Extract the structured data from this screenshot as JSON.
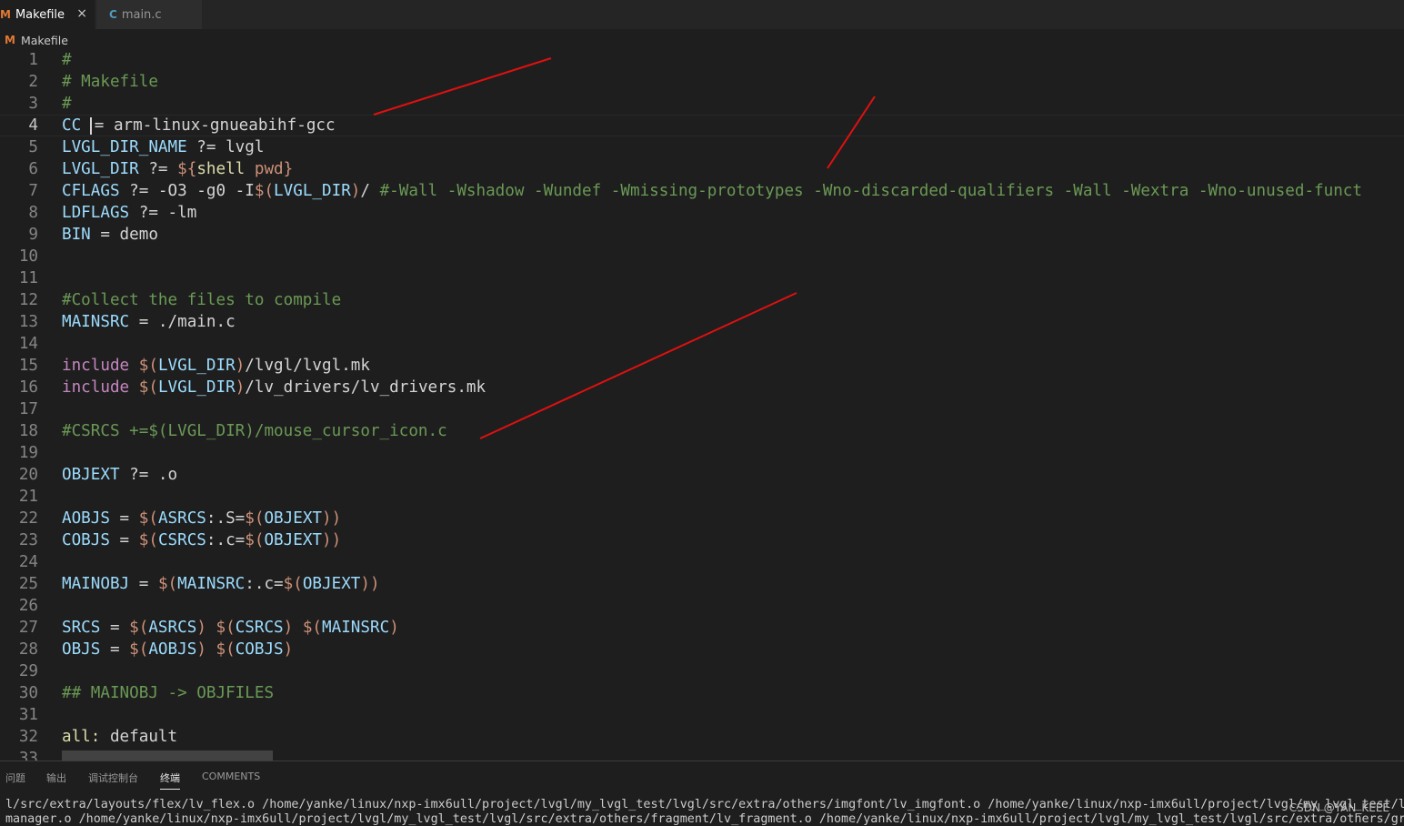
{
  "tabs": [
    {
      "icon": "M",
      "label": "Makefile",
      "active": true,
      "close": "×"
    },
    {
      "icon": "C",
      "label": "main.c",
      "active": false
    }
  ],
  "breadcrumb": {
    "icon": "M",
    "label": "Makefile"
  },
  "current_line": 4,
  "colors": {
    "background": "#1e1e1e",
    "comment": "#6a9955",
    "variable": "#9cdcfe",
    "keyword": "#c586c0",
    "dollar": "#ce9178",
    "function": "#dcdcaa",
    "annotation": "#e01010"
  },
  "editor": {
    "lines": [
      {
        "n": "1",
        "tokens": [
          {
            "t": "#",
            "c": "com"
          }
        ]
      },
      {
        "n": "2",
        "tokens": [
          {
            "t": "# Makefile",
            "c": "com"
          }
        ]
      },
      {
        "n": "3",
        "tokens": [
          {
            "t": "#",
            "c": "com"
          }
        ]
      },
      {
        "n": "4",
        "tokens": [
          {
            "t": "CC",
            "c": "var"
          },
          {
            "t": " ",
            "c": "txt"
          },
          {
            "t": "",
            "c": "cursor"
          },
          {
            "t": "= arm-linux-gnueabihf-gcc",
            "c": "txt"
          }
        ]
      },
      {
        "n": "5",
        "tokens": [
          {
            "t": "LVGL_DIR_NAME",
            "c": "var"
          },
          {
            "t": " ?= lvgl",
            "c": "txt"
          }
        ]
      },
      {
        "n": "6",
        "tokens": [
          {
            "t": "LVGL_DIR",
            "c": "var"
          },
          {
            "t": " ?= ",
            "c": "txt"
          },
          {
            "t": "${",
            "c": "dol"
          },
          {
            "t": "shell",
            "c": "fn"
          },
          {
            "t": " pwd}",
            "c": "dol"
          }
        ]
      },
      {
        "n": "7",
        "tokens": [
          {
            "t": "CFLAGS",
            "c": "var"
          },
          {
            "t": " ?= -O3 -g0 -I",
            "c": "txt"
          },
          {
            "t": "$(",
            "c": "dol"
          },
          {
            "t": "LVGL_DIR",
            "c": "var"
          },
          {
            "t": ")",
            "c": "dol"
          },
          {
            "t": "/ ",
            "c": "txt"
          },
          {
            "t": "#-Wall -Wshadow -Wundef -Wmissing-prototypes -Wno-discarded-qualifiers -Wall -Wextra -Wno-unused-funct",
            "c": "com"
          }
        ]
      },
      {
        "n": "8",
        "tokens": [
          {
            "t": "LDFLAGS",
            "c": "var"
          },
          {
            "t": " ?= -lm",
            "c": "txt"
          }
        ]
      },
      {
        "n": "9",
        "tokens": [
          {
            "t": "BIN",
            "c": "var"
          },
          {
            "t": " = demo",
            "c": "txt"
          }
        ]
      },
      {
        "n": "10",
        "tokens": []
      },
      {
        "n": "11",
        "tokens": []
      },
      {
        "n": "12",
        "tokens": [
          {
            "t": "#Collect the files to compile",
            "c": "com"
          }
        ]
      },
      {
        "n": "13",
        "tokens": [
          {
            "t": "MAINSRC",
            "c": "var"
          },
          {
            "t": " = ./main.c",
            "c": "txt"
          }
        ]
      },
      {
        "n": "14",
        "tokens": []
      },
      {
        "n": "15",
        "tokens": [
          {
            "t": "include",
            "c": "kw"
          },
          {
            "t": " ",
            "c": "txt"
          },
          {
            "t": "$(",
            "c": "dol"
          },
          {
            "t": "LVGL_DIR",
            "c": "var"
          },
          {
            "t": ")",
            "c": "dol"
          },
          {
            "t": "/lvgl/lvgl.mk",
            "c": "txt"
          }
        ]
      },
      {
        "n": "16",
        "tokens": [
          {
            "t": "include",
            "c": "kw"
          },
          {
            "t": " ",
            "c": "txt"
          },
          {
            "t": "$(",
            "c": "dol"
          },
          {
            "t": "LVGL_DIR",
            "c": "var"
          },
          {
            "t": ")",
            "c": "dol"
          },
          {
            "t": "/lv_drivers/lv_drivers.mk",
            "c": "txt"
          }
        ]
      },
      {
        "n": "17",
        "tokens": []
      },
      {
        "n": "18",
        "tokens": [
          {
            "t": "#CSRCS +=$(LVGL_DIR)/mouse_cursor_icon.c",
            "c": "com"
          }
        ]
      },
      {
        "n": "19",
        "tokens": []
      },
      {
        "n": "20",
        "tokens": [
          {
            "t": "OBJEXT",
            "c": "var"
          },
          {
            "t": " ?= .o",
            "c": "txt"
          }
        ]
      },
      {
        "n": "21",
        "tokens": []
      },
      {
        "n": "22",
        "tokens": [
          {
            "t": "AOBJS",
            "c": "var"
          },
          {
            "t": " = ",
            "c": "txt"
          },
          {
            "t": "$(",
            "c": "dol"
          },
          {
            "t": "ASRCS",
            "c": "var"
          },
          {
            "t": ":.S=",
            "c": "txt"
          },
          {
            "t": "$(",
            "c": "dol"
          },
          {
            "t": "OBJEXT",
            "c": "var"
          },
          {
            "t": "))",
            "c": "dol"
          }
        ]
      },
      {
        "n": "23",
        "tokens": [
          {
            "t": "COBJS",
            "c": "var"
          },
          {
            "t": " = ",
            "c": "txt"
          },
          {
            "t": "$(",
            "c": "dol"
          },
          {
            "t": "CSRCS",
            "c": "var"
          },
          {
            "t": ":.c=",
            "c": "txt"
          },
          {
            "t": "$(",
            "c": "dol"
          },
          {
            "t": "OBJEXT",
            "c": "var"
          },
          {
            "t": "))",
            "c": "dol"
          }
        ]
      },
      {
        "n": "24",
        "tokens": []
      },
      {
        "n": "25",
        "tokens": [
          {
            "t": "MAINOBJ",
            "c": "var"
          },
          {
            "t": " = ",
            "c": "txt"
          },
          {
            "t": "$(",
            "c": "dol"
          },
          {
            "t": "MAINSRC",
            "c": "var"
          },
          {
            "t": ":.c=",
            "c": "txt"
          },
          {
            "t": "$(",
            "c": "dol"
          },
          {
            "t": "OBJEXT",
            "c": "var"
          },
          {
            "t": "))",
            "c": "dol"
          }
        ]
      },
      {
        "n": "26",
        "tokens": []
      },
      {
        "n": "27",
        "tokens": [
          {
            "t": "SRCS",
            "c": "var"
          },
          {
            "t": " = ",
            "c": "txt"
          },
          {
            "t": "$(",
            "c": "dol"
          },
          {
            "t": "ASRCS",
            "c": "var"
          },
          {
            "t": ")",
            "c": "dol"
          },
          {
            "t": " ",
            "c": "txt"
          },
          {
            "t": "$(",
            "c": "dol"
          },
          {
            "t": "CSRCS",
            "c": "var"
          },
          {
            "t": ")",
            "c": "dol"
          },
          {
            "t": " ",
            "c": "txt"
          },
          {
            "t": "$(",
            "c": "dol"
          },
          {
            "t": "MAINSRC",
            "c": "var"
          },
          {
            "t": ")",
            "c": "dol"
          }
        ]
      },
      {
        "n": "28",
        "tokens": [
          {
            "t": "OBJS",
            "c": "var"
          },
          {
            "t": " = ",
            "c": "txt"
          },
          {
            "t": "$(",
            "c": "dol"
          },
          {
            "t": "AOBJS",
            "c": "var"
          },
          {
            "t": ")",
            "c": "dol"
          },
          {
            "t": " ",
            "c": "txt"
          },
          {
            "t": "$(",
            "c": "dol"
          },
          {
            "t": "COBJS",
            "c": "var"
          },
          {
            "t": ")",
            "c": "dol"
          }
        ]
      },
      {
        "n": "29",
        "tokens": []
      },
      {
        "n": "30",
        "tokens": [
          {
            "t": "## MAINOBJ -> OBJFILES",
            "c": "com"
          }
        ]
      },
      {
        "n": "31",
        "tokens": []
      },
      {
        "n": "32",
        "tokens": [
          {
            "t": "all:",
            "c": "fn"
          },
          {
            "t": " default",
            "c": "txt"
          }
        ]
      },
      {
        "n": "33",
        "tokens": []
      }
    ]
  },
  "panel": {
    "tabs": [
      "问题",
      "输出",
      "调试控制台",
      "终端",
      "COMMENTS"
    ],
    "active_tab": "终端",
    "terminal_lines": [
      "l/src/extra/layouts/flex/lv_flex.o /home/yanke/linux/nxp-imx6ull/project/lvgl/my_lvgl_test/lvgl/src/extra/others/imgfont/lv_imgfont.o /home/yanke/linux/nxp-imx6ull/project/lvgl/my_lvgl_test/lvgl",
      "manager.o /home/yanke/linux/nxp-imx6ull/project/lvgl/my_lvgl_test/lvgl/src/extra/others/fragment/lv_fragment.o /home/yanke/linux/nxp-imx6ull/project/lvgl/my_lvgl_test/lvgl/src/extra/others/gridnav"
    ],
    "watermark": "CSDN @YAN_KEEE"
  }
}
